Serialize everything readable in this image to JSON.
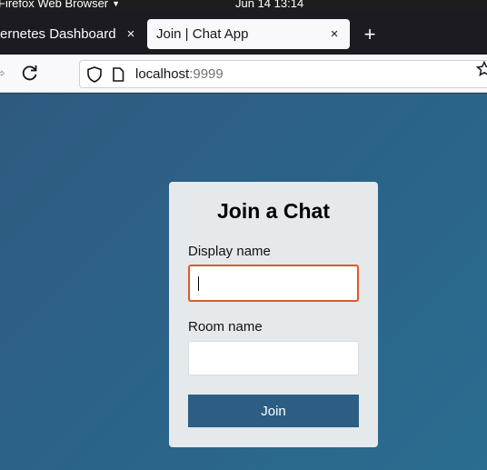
{
  "system_bar": {
    "app_menu": "Firefox Web Browser",
    "clock": "Jun 14  13:14"
  },
  "tabs": [
    {
      "label": "ernetes Dashboard",
      "active": false
    },
    {
      "label": "Join | Chat App",
      "active": true
    }
  ],
  "tab_close_glyph": "×",
  "new_tab_glyph": "+",
  "address_bar": {
    "host": "localhost",
    "port": ":9999"
  },
  "join_form": {
    "title": "Join a Chat",
    "display_name_label": "Display name",
    "display_name_value": "",
    "room_name_label": "Room name",
    "room_name_value": "",
    "submit_label": "Join"
  },
  "colors": {
    "page_background": "#2b6488",
    "focus_ring": "#e0572a",
    "button": "#2b5e82",
    "card": "#e5e9ec"
  }
}
